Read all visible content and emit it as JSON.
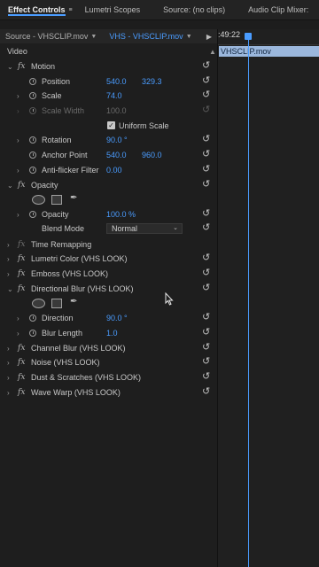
{
  "tabs": [
    {
      "label": "Effect Controls"
    },
    {
      "label": "Lumetri Scopes"
    },
    {
      "label": "Source: (no clips)"
    },
    {
      "label": "Audio Clip Mixer:"
    }
  ],
  "source_bar": {
    "source": "Source - VHSCLIP.mov",
    "sequence_clip": "VHS - VHSCLIP.mov"
  },
  "timeline": {
    "timecode": ":49:22",
    "clip_name": "VHSCLIP.mov"
  },
  "section_header": "Video",
  "effects": {
    "motion": {
      "name": "Motion",
      "position": {
        "label": "Position",
        "x": "540.0",
        "y": "329.3"
      },
      "scale": {
        "label": "Scale",
        "value": "74.0"
      },
      "scale_width": {
        "label": "Scale Width",
        "value": "100.0"
      },
      "uniform_scale": {
        "label": "Uniform Scale",
        "checked": true
      },
      "rotation": {
        "label": "Rotation",
        "value": "90.0 °"
      },
      "anchor_point": {
        "label": "Anchor Point",
        "x": "540.0",
        "y": "960.0"
      },
      "anti_flicker": {
        "label": "Anti-flicker Filter",
        "value": "0.00"
      }
    },
    "opacity": {
      "name": "Opacity",
      "opacity": {
        "label": "Opacity",
        "value": "100.0 %"
      },
      "blend_mode": {
        "label": "Blend Mode",
        "value": "Normal"
      }
    },
    "time_remapping": {
      "name": "Time Remapping"
    },
    "lumetri": {
      "name": "Lumetri Color (VHS LOOK)"
    },
    "emboss": {
      "name": "Emboss (VHS LOOK)"
    },
    "directional_blur": {
      "name": "Directional Blur (VHS LOOK)",
      "direction": {
        "label": "Direction",
        "value": "90.0 °"
      },
      "blur_length": {
        "label": "Blur Length",
        "value": "1.0"
      }
    },
    "channel_blur": {
      "name": "Channel Blur (VHS LOOK)"
    },
    "noise": {
      "name": "Noise (VHS LOOK)"
    },
    "dust": {
      "name": "Dust & Scratches (VHS LOOK)"
    },
    "wave_warp": {
      "name": "Wave Warp (VHS LOOK)"
    }
  },
  "colors": {
    "accent": "#4a9cff",
    "clip": "#9bb7dc",
    "background": "#1d1d1d"
  },
  "icons": {
    "reset": "reset-icon",
    "stopwatch": "stopwatch-icon",
    "fx": "fx-badge",
    "pen": "pen-icon"
  }
}
